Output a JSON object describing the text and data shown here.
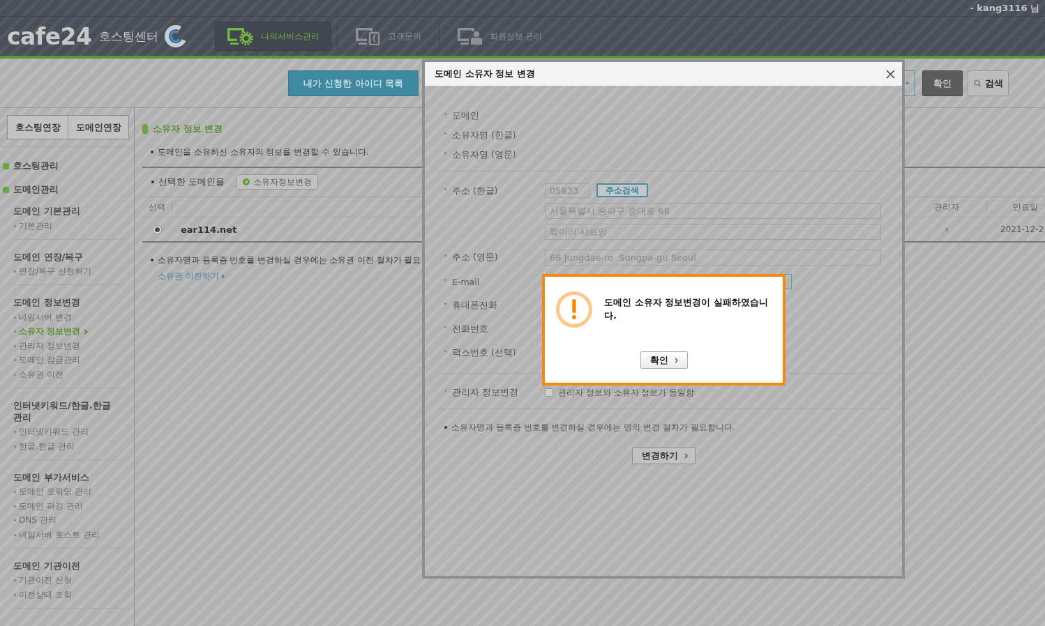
{
  "top_bar": {
    "user": "- kang3116 님"
  },
  "header": {
    "logo": "cafe24",
    "logo_caption": "호스팅센터",
    "nav": [
      {
        "label": "나의서비스관리",
        "selected": true
      },
      {
        "label": "고객문의",
        "selected": false
      },
      {
        "label": "회원정보 관리",
        "selected": false
      }
    ]
  },
  "toolbar": {
    "id_list_button": "내가 신청한 아이디 목록",
    "confirm_button": "확인",
    "search_button": "검색"
  },
  "sidebar": {
    "buttons": [
      "호스팅연장",
      "도메인연장"
    ],
    "menus": [
      {
        "label": "호스팅관리"
      },
      {
        "label": "도메인관리",
        "children": [
          {
            "label": "도메인 기본관리",
            "children": [
              {
                "label": "기본관리",
                "selected": false
              }
            ]
          },
          {
            "label": "도메인 연장/복구",
            "children": [
              {
                "label": "연장/복구 신청하기",
                "selected": false
              }
            ]
          },
          {
            "label": "도메인 정보변경",
            "children": [
              {
                "label": "네임서버 변경",
                "selected": false
              },
              {
                "label": "소유자 정보변경",
                "selected": true
              },
              {
                "label": "관리자 정보변경",
                "selected": false
              },
              {
                "label": "도메인 잠금관리",
                "selected": false
              },
              {
                "label": "소유권 이전",
                "selected": false
              }
            ]
          },
          {
            "label": "인터넷키워드/한글.한글 관리",
            "children": [
              {
                "label": "인터넷키워드 관리",
                "selected": false
              },
              {
                "label": "한글.한글 관리",
                "selected": false
              }
            ]
          },
          {
            "label": "도메인 부가서비스",
            "children": [
              {
                "label": "도메인 포워딩 관리",
                "selected": false
              },
              {
                "label": "도메인 파킹 관리",
                "selected": false
              },
              {
                "label": "DNS 관리",
                "selected": false
              },
              {
                "label": "네임서버 호스트 관리",
                "selected": false
              }
            ]
          },
          {
            "label": "도메인 기관이전",
            "children": [
              {
                "label": "기관이전 신청",
                "selected": false
              },
              {
                "label": "이전상태 조회",
                "selected": false
              }
            ]
          }
        ]
      }
    ]
  },
  "content": {
    "title": "소유자 정보 변경",
    "description": "도메인을 소유하신 소유자의 정보를 변경할 수 있습니다.",
    "action_label": "선택한 도메인을",
    "action_button": "소유자정보변경",
    "table": {
      "columns": [
        "선택",
        "관리자",
        "만료일"
      ],
      "rows": [
        {
          "selected": true,
          "domain": "ear114.net",
          "manager": "›",
          "expiry": "2021-12-2"
        }
      ]
    },
    "note": "소유자명과 등록증 번호를 변경하실 경우에는 소유권 이전 절차가 필요",
    "link": "소유권 이전하기"
  },
  "modal": {
    "title": "도메인 소유자 정보 변경",
    "groups": [
      {
        "rows": [
          {
            "kind": "plain",
            "label": "도메인"
          },
          {
            "kind": "plain",
            "label": "소유자명 (한글)"
          },
          {
            "kind": "plain",
            "label": "소유자명 (영문)"
          }
        ]
      },
      {
        "rows": [
          {
            "kind": "address",
            "label": "주소 (한글)",
            "zip": "05833",
            "search_button": "주소검색",
            "lines": [
              "서울특별시 송파구 중대로 68",
              "훼미리 샤르망"
            ]
          },
          {
            "kind": "input",
            "label": "주소 (영문)",
            "value": "68 Jungdae-ro  Songpa-gu Seoul"
          },
          {
            "kind": "covered_input",
            "label": "E-mail"
          },
          {
            "kind": "plain",
            "label": "휴대폰전화"
          },
          {
            "kind": "plain",
            "label": "전화번호"
          },
          {
            "kind": "plain",
            "label": "팩스번호 (선택)"
          }
        ]
      },
      {
        "rows": [
          {
            "kind": "checkbox",
            "label": "관리자 정보변경",
            "checked": false,
            "text": "관리자 정보와 소유자 정보가 동일함"
          }
        ]
      }
    ],
    "note": "소유자명과 등록증 번호를 변경하실 경우에는 명의 변경 절차가 필요합니다.",
    "submit_button": "변경하기"
  },
  "alert": {
    "message": "도메인 소유자 정보변경이 실패하였습니다.",
    "button": "확인"
  }
}
